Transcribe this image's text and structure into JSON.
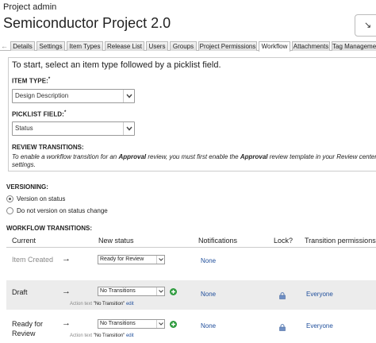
{
  "breadcrumb": "Project admin",
  "page_title": "Semiconductor Project 2.0",
  "title_action_glyph": "↘",
  "tabs": {
    "scroll_left": "←",
    "items": [
      "Details",
      "Settings",
      "Item Types",
      "Release List",
      "Users",
      "Groups",
      "Project Permissions",
      "Workflow",
      "Attachments",
      "Tag Management"
    ],
    "active": "Workflow"
  },
  "intro_text": "To start, select an item type followed by a picklist field.",
  "item_type": {
    "label": "ITEM TYPE:",
    "required_mark": "*",
    "value": "Design Description"
  },
  "picklist_field": {
    "label": "PICKLIST FIELD:",
    "required_mark": "*",
    "value": "Status"
  },
  "review_transitions": {
    "title": "REVIEW TRANSITIONS:",
    "note_start": "To enable a workflow transition for an ",
    "note_bold1": "Approval",
    "note_mid": " review, you must first enable the ",
    "note_bold2": "Approval",
    "note_end": " review template in your Review center settings."
  },
  "versioning": {
    "label": "VERSIONING:",
    "options": [
      {
        "label": "Version on status",
        "checked": true
      },
      {
        "label": "Do not version on status change",
        "checked": false
      }
    ]
  },
  "workflow_transitions": {
    "label": "WORKFLOW TRANSITIONS:",
    "columns": [
      "Current",
      "New status",
      "Notifications",
      "Lock?",
      "Transition permissions"
    ],
    "rows": [
      {
        "current": "Item Created",
        "arrow": "→",
        "new_status": "Ready for Review",
        "notifications": "None",
        "permissions": "",
        "action_prefix": "",
        "action_value": "",
        "action_edit": ""
      },
      {
        "current": "Draft",
        "arrow": "→",
        "new_status": "No Transitions",
        "notifications": "None",
        "permissions": "Everyone",
        "action_prefix": "Action text",
        "action_value": "\"No Transition\"",
        "action_edit": "edit"
      },
      {
        "current": "Ready for Review",
        "arrow": "→",
        "new_status": "No Transitions",
        "notifications": "None",
        "permissions": "Everyone",
        "action_prefix": "Action text",
        "action_value": "\"No Transition\"",
        "action_edit": "edit"
      }
    ]
  },
  "colors": {
    "link": "#1f4e9b",
    "add": "#2e9b3e",
    "alt_row": "#ececec"
  }
}
